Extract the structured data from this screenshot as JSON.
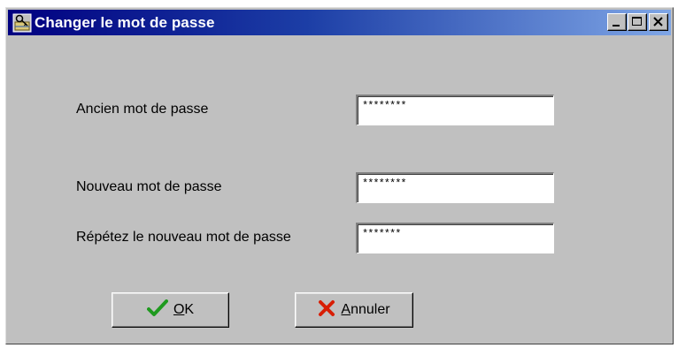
{
  "window": {
    "title": "Changer le mot de passe",
    "icons": {
      "app": "key-dialog-icon",
      "minimize": "minimize-icon",
      "maximize": "maximize-icon",
      "close": "close-icon"
    }
  },
  "form": {
    "fields": [
      {
        "label": "Ancien mot de passe",
        "value": "********"
      },
      {
        "label": "Nouveau mot de passe",
        "value": "********"
      },
      {
        "label": "Répétez le nouveau mot de passe",
        "value": "*******"
      }
    ]
  },
  "buttons": {
    "ok": {
      "mnemonic": "O",
      "rest": "K",
      "icon": "checkmark-icon",
      "icon_color": "#1f9a1f"
    },
    "cancel": {
      "mnemonic": "A",
      "rest": "nnuler",
      "icon": "x-cross-icon",
      "icon_color": "#d81e05"
    }
  },
  "colors": {
    "titlebar_start": "#000080",
    "titlebar_end": "#7fa6e6",
    "dialog_bg": "#c0c0c0"
  }
}
